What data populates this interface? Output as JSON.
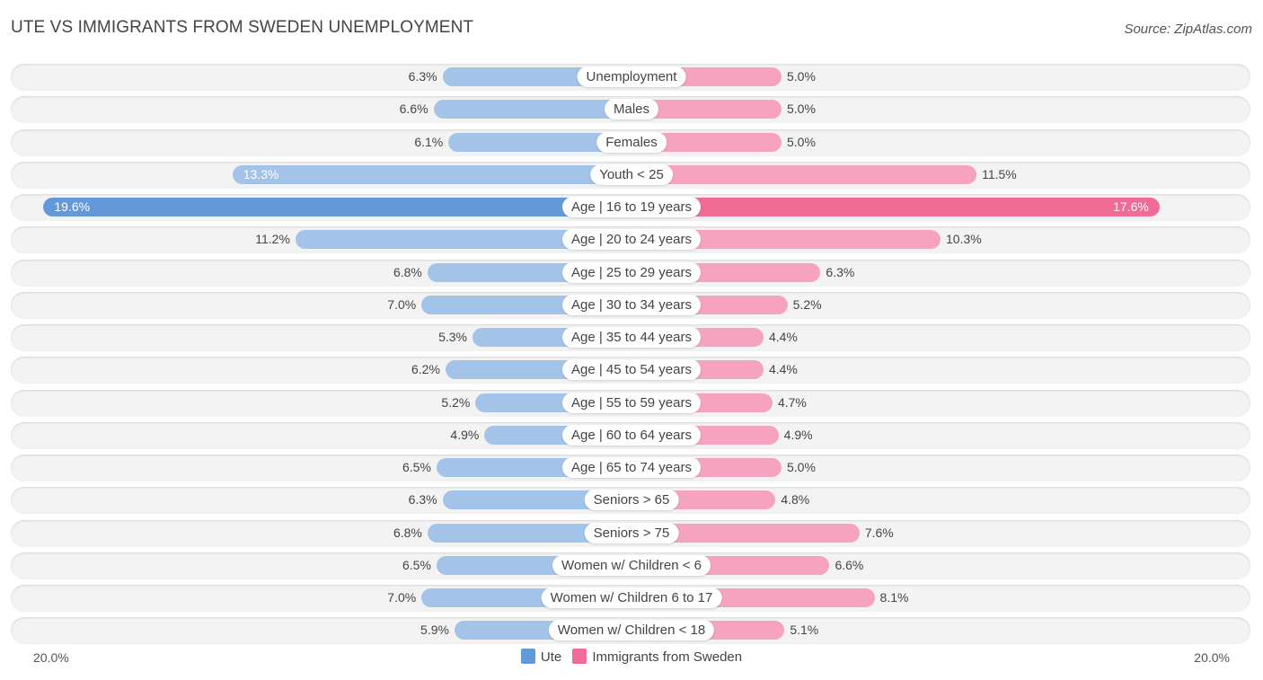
{
  "header": {
    "title": "UTE VS IMMIGRANTS FROM SWEDEN UNEMPLOYMENT",
    "source": "Source: ZipAtlas.com"
  },
  "colors": {
    "ute": "#a3c4e8",
    "ute_highlight": "#6399d9",
    "immigrants": "#f5a3be",
    "immigrants_highlight": "#f06b96",
    "legend_ute": "#6399d9",
    "legend_immigrants": "#f06b96"
  },
  "chart_data": {
    "type": "bar",
    "orientation": "horizontal-diverging",
    "title": "UTE VS IMMIGRANTS FROM SWEDEN UNEMPLOYMENT",
    "xlabel": "",
    "ylabel": "",
    "xlim": [
      0,
      20
    ],
    "axis_labels": {
      "left": "20.0%",
      "right": "20.0%"
    },
    "legend": {
      "position": "bottom-center",
      "entries": [
        "Ute",
        "Immigrants from Sweden"
      ]
    },
    "categories": [
      "Unemployment",
      "Males",
      "Females",
      "Youth < 25",
      "Age | 16 to 19 years",
      "Age | 20 to 24 years",
      "Age | 25 to 29 years",
      "Age | 30 to 34 years",
      "Age | 35 to 44 years",
      "Age | 45 to 54 years",
      "Age | 55 to 59 years",
      "Age | 60 to 64 years",
      "Age | 65 to 74 years",
      "Seniors > 65",
      "Seniors > 75",
      "Women w/ Children < 6",
      "Women w/ Children 6 to 17",
      "Women w/ Children < 18"
    ],
    "series": [
      {
        "name": "Ute",
        "side": "left",
        "values": [
          6.3,
          6.6,
          6.1,
          13.3,
          19.6,
          11.2,
          6.8,
          7.0,
          5.3,
          6.2,
          5.2,
          4.9,
          6.5,
          6.3,
          6.8,
          6.5,
          7.0,
          5.9
        ],
        "labels": [
          "6.3%",
          "6.6%",
          "6.1%",
          "13.3%",
          "19.6%",
          "11.2%",
          "6.8%",
          "7.0%",
          "5.3%",
          "6.2%",
          "5.2%",
          "4.9%",
          "6.5%",
          "6.3%",
          "6.8%",
          "6.5%",
          "7.0%",
          "5.9%"
        ]
      },
      {
        "name": "Immigrants from Sweden",
        "side": "right",
        "values": [
          5.0,
          5.0,
          5.0,
          11.5,
          17.6,
          10.3,
          6.3,
          5.2,
          4.4,
          4.4,
          4.7,
          4.9,
          5.0,
          4.8,
          7.6,
          6.6,
          8.1,
          5.1
        ],
        "labels": [
          "5.0%",
          "5.0%",
          "5.0%",
          "11.5%",
          "17.6%",
          "10.3%",
          "6.3%",
          "5.2%",
          "4.4%",
          "4.4%",
          "4.7%",
          "4.9%",
          "5.0%",
          "4.8%",
          "7.6%",
          "6.6%",
          "8.1%",
          "5.1%"
        ]
      }
    ]
  }
}
